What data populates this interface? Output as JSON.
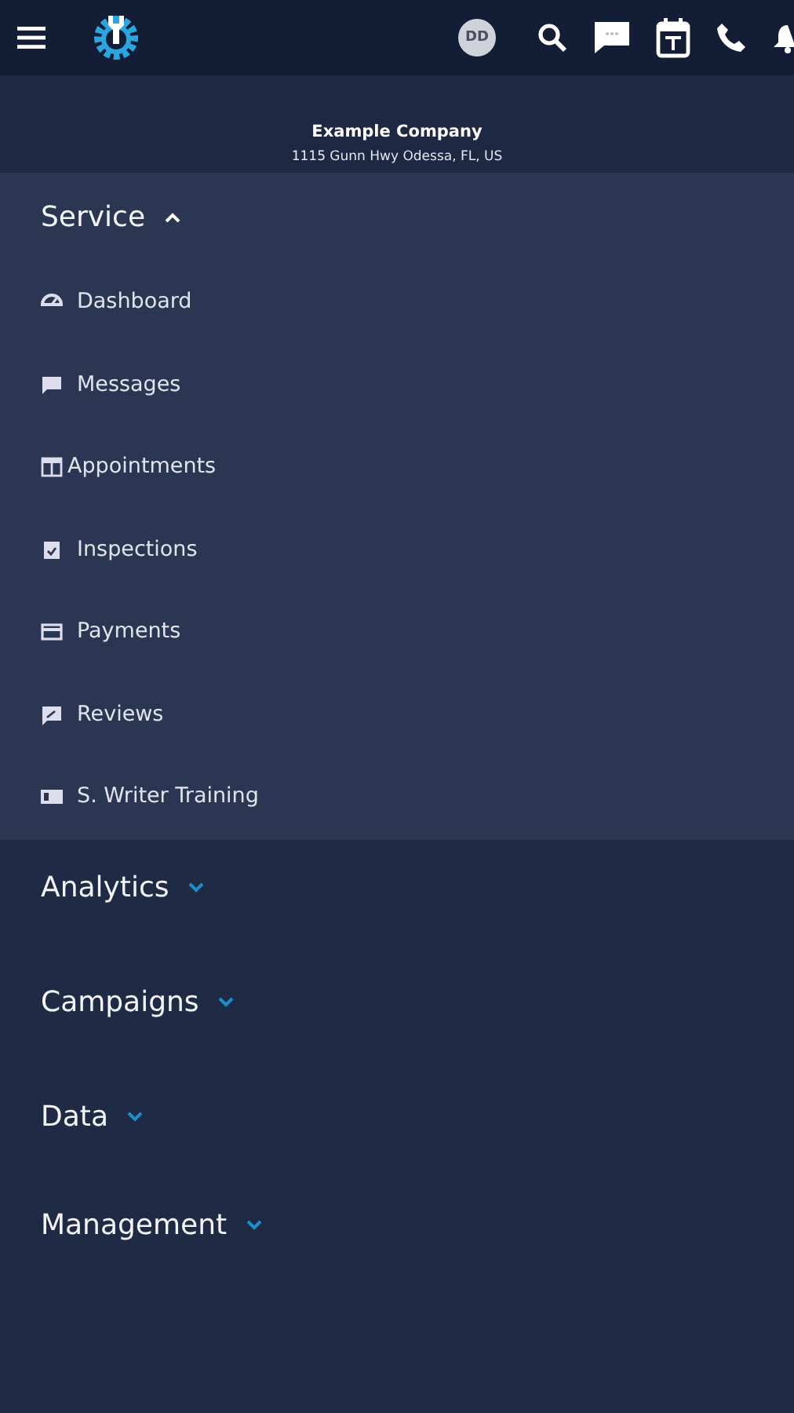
{
  "top_bar": {
    "avatar": "DD"
  },
  "company": {
    "name": "Example Company",
    "address": "1115 Gunn Hwy Odessa, FL, US"
  },
  "sections": [
    {
      "label": "Service",
      "expanded": true,
      "items": [
        {
          "label": "Dashboard"
        },
        {
          "label": "Messages"
        },
        {
          "label": "Appointments"
        },
        {
          "label": "Inspections"
        },
        {
          "label": "Payments"
        },
        {
          "label": "Reviews"
        },
        {
          "label": "S. Writer Training"
        }
      ]
    },
    {
      "label": "Analytics",
      "expanded": false
    },
    {
      "label": "Campaigns",
      "expanded": false
    },
    {
      "label": "Data",
      "expanded": false
    },
    {
      "label": "Management",
      "expanded": false
    }
  ]
}
